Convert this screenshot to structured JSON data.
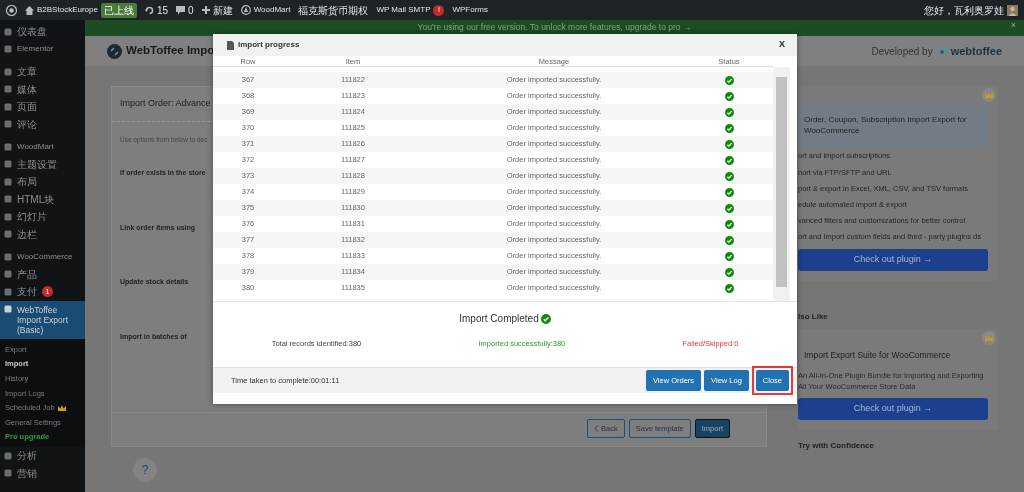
{
  "admin_bar": {
    "site": "B2BStockEurope",
    "site_badge": "已上线",
    "updates": "15",
    "comments": "0",
    "new": "新建",
    "menu": [
      {
        "label": "WoodMart",
        "kind": "icon"
      },
      {
        "label": "福克斯货币期权",
        "kind": "plain"
      },
      {
        "label": "WP Mail SMTP",
        "kind": "alert",
        "badge": "!"
      },
      {
        "label": "WPForms",
        "kind": "plain"
      }
    ],
    "greeting": "您好，瓦利奥罗娃"
  },
  "sidebar": {
    "groups": [
      {
        "items": [
          {
            "label": "仪表盘",
            "current": false
          },
          {
            "label": "Elementor",
            "current": false
          }
        ]
      },
      {
        "items": [
          {
            "label": "文章",
            "current": false
          },
          {
            "label": "媒体",
            "current": false
          },
          {
            "label": "页面",
            "current": false
          },
          {
            "label": "评论",
            "current": false
          }
        ]
      },
      {
        "items": [
          {
            "label": "WoodMart",
            "current": false
          },
          {
            "label": "主题设置",
            "current": false
          },
          {
            "label": "布局",
            "current": false
          },
          {
            "label": "HTML块",
            "current": false
          },
          {
            "label": "幻灯片",
            "current": false
          },
          {
            "label": "边栏",
            "current": false
          }
        ]
      },
      {
        "items": [
          {
            "label": "WooCommerce",
            "current": false
          },
          {
            "label": "产品",
            "current": false
          },
          {
            "label": "支付",
            "current": false,
            "badge": "1"
          },
          {
            "label": "WebToffee Import Export (Basic)",
            "current": true,
            "children": [
              {
                "label": "Export",
                "selected": false,
                "kind": "link",
                "premium": false
              },
              {
                "label": "Import",
                "selected": true,
                "kind": "link",
                "premium": false
              },
              {
                "label": "History",
                "selected": false,
                "kind": "link",
                "premium": false
              },
              {
                "label": "Import Logs",
                "selected": false,
                "kind": "link",
                "premium": false
              },
              {
                "label": "Scheduled Job",
                "selected": false,
                "kind": "link",
                "premium": true
              },
              {
                "label": "General Settings",
                "selected": false,
                "kind": "link",
                "premium": false
              },
              {
                "label": "Pro upgrade",
                "selected": false,
                "kind": "upgrade",
                "premium": false
              }
            ]
          },
          {
            "label": "分析",
            "current": false
          },
          {
            "label": "营销",
            "current": false
          }
        ]
      }
    ]
  },
  "banner": {
    "text": "You're using our free version. To unlock more features, upgrade to pro →",
    "close": "×"
  },
  "header": {
    "title": "WebToffee Impo",
    "developed_by": "Developed by",
    "brand": "webtoffee"
  },
  "form": {
    "title": "Import Order: Advance",
    "intro": "Use options from below to dec",
    "fields": [
      "If order exists in the store",
      "Link order items using",
      "Update stock details",
      "Import in batches of"
    ],
    "buttons": [
      {
        "label": "Back",
        "kind": "back"
      },
      {
        "label": "Save template",
        "kind": "secondary"
      },
      {
        "label": "Import",
        "kind": "primary"
      }
    ],
    "help": "?"
  },
  "promos": [
    {
      "title": "Order, Coupon, Subscription Import Export for WooCommerce",
      "premium": true,
      "features": [
        "ort and import subscriptions",
        "nort via FTP/SFTP and URL",
        "port & export in Excel, XML, CSV, and TSV formats",
        "edule automated import & export",
        "vanced filters and customizations for better control",
        "ort and Import custom fields and third - party plugins ds"
      ],
      "button": "Check out plugin →"
    },
    {
      "heading": "lso Like",
      "title": "Import Export Suite for WooCommerce",
      "premium": true,
      "description": "An All-In-One Plugin Bundle for Importing and Exporting All Your WooCommerce Store Data",
      "button": "Check out plugin →"
    }
  ],
  "try_heading": "Try with Confidence",
  "modal": {
    "title": "Import progress",
    "close": "X",
    "columns": [
      "Row",
      "Item",
      "Message",
      "Status"
    ],
    "rows": [
      {
        "row": "367",
        "item": "111822",
        "message": "Order imported successfully.",
        "imported": true
      },
      {
        "row": "368",
        "item": "111823",
        "message": "Order imported successfully.",
        "imported": true
      },
      {
        "row": "369",
        "item": "111824",
        "message": "Order imported successfully.",
        "imported": true
      },
      {
        "row": "370",
        "item": "111825",
        "message": "Order imported successfully.",
        "imported": true
      },
      {
        "row": "371",
        "item": "111826",
        "message": "Order imported successfully.",
        "imported": true
      },
      {
        "row": "372",
        "item": "111827",
        "message": "Order imported successfully.",
        "imported": true
      },
      {
        "row": "373",
        "item": "111828",
        "message": "Order imported successfully.",
        "imported": true
      },
      {
        "row": "374",
        "item": "111829",
        "message": "Order imported successfully.",
        "imported": true
      },
      {
        "row": "375",
        "item": "111830",
        "message": "Order imported successfully.",
        "imported": true
      },
      {
        "row": "376",
        "item": "111831",
        "message": "Order imported successfully.",
        "imported": true
      },
      {
        "row": "377",
        "item": "111832",
        "message": "Order imported successfully.",
        "imported": true
      },
      {
        "row": "378",
        "item": "111833",
        "message": "Order imported successfully.",
        "imported": true
      },
      {
        "row": "379",
        "item": "111834",
        "message": "Order imported successfully.",
        "imported": true
      },
      {
        "row": "380",
        "item": "111835",
        "message": "Order imported successfully.",
        "imported": true
      }
    ],
    "summary": {
      "title": "Import Completed",
      "completed": true,
      "stats": [
        {
          "text": "Total records identified:380",
          "kind": "total"
        },
        {
          "text": "Imported successfully:380",
          "kind": "success"
        },
        {
          "text": "Failed/Skipped:0",
          "kind": "failed"
        }
      ]
    },
    "time": "Time taken to complete:00:01:11",
    "buttons": [
      {
        "label": "View Orders",
        "highlighted": false
      },
      {
        "label": "View Log",
        "highlighted": false
      },
      {
        "label": "Close",
        "highlighted": true
      }
    ]
  }
}
